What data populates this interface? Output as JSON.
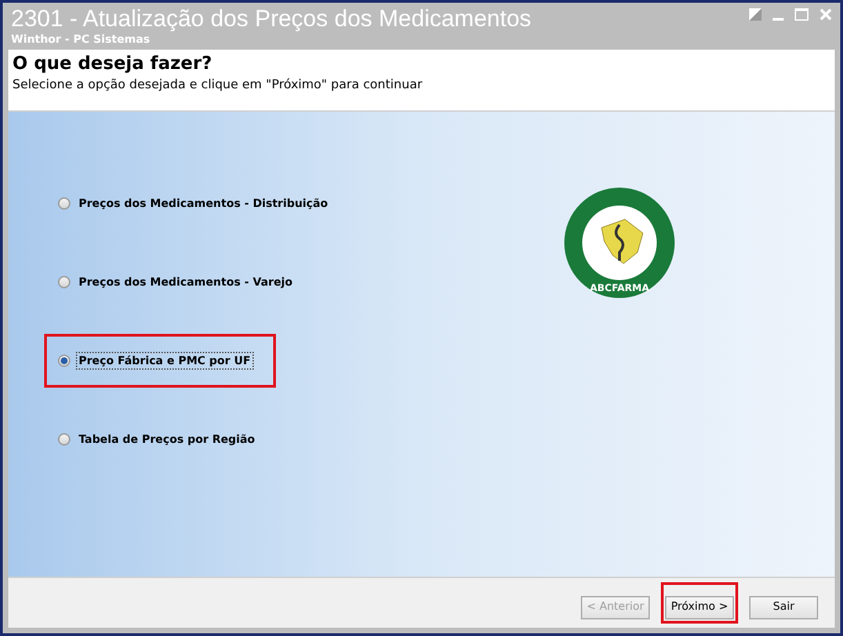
{
  "window": {
    "title": "2301 - Atualização dos Preços dos Medicamentos",
    "subtitle": "Winthor - PC Sistemas"
  },
  "header": {
    "heading": "O que deseja fazer?",
    "instruction": "Selecione a opção desejada e clique em \"Próximo\" para continuar"
  },
  "options": [
    {
      "label": "Preços dos Medicamentos - Distribuição",
      "selected": false,
      "highlighted": false
    },
    {
      "label": "Preços dos Medicamentos - Varejo",
      "selected": false,
      "highlighted": false
    },
    {
      "label": "Preço Fábrica e PMC por UF",
      "selected": true,
      "highlighted": true
    },
    {
      "label": "Tabela de Preços por Região",
      "selected": false,
      "highlighted": false
    }
  ],
  "logo": {
    "name": "ABCFARMA"
  },
  "buttons": [
    {
      "label": "< Anterior",
      "disabled": true,
      "highlighted": false
    },
    {
      "label": "Próximo >",
      "disabled": false,
      "highlighted": true
    },
    {
      "label": "Sair",
      "disabled": false,
      "highlighted": false
    }
  ]
}
